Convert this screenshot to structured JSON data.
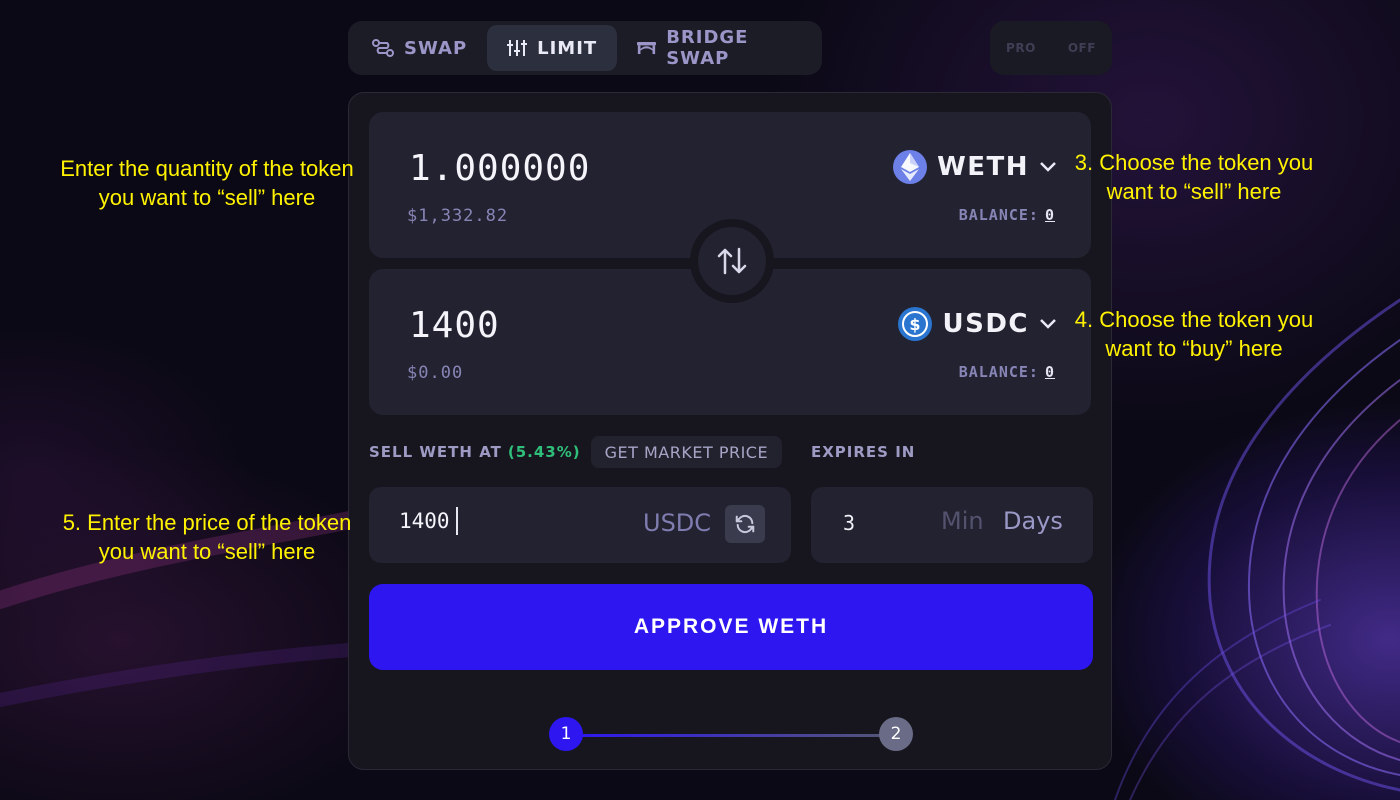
{
  "tabs": [
    {
      "label": "SWAP",
      "icon": "route-icon",
      "active": false
    },
    {
      "label": "LIMIT",
      "icon": "sliders-icon",
      "active": true
    },
    {
      "label": "BRIDGE SWAP",
      "icon": "bridge-icon",
      "active": false
    }
  ],
  "pro_toggle": {
    "pro": "PRO",
    "off": "OFF"
  },
  "sell": {
    "amount": "1.000000",
    "usd": "$1,332.82",
    "token": "WETH",
    "token_icon": "ethereum-icon",
    "balance_label": "BALANCE:",
    "balance_value": "0"
  },
  "buy": {
    "amount": "1400",
    "usd": "$0.00",
    "token": "USDC",
    "token_icon": "usdc-icon",
    "balance_label": "BALANCE:",
    "balance_value": "0"
  },
  "limit": {
    "sell_at_label": "SELL WETH AT",
    "pct": "(5.43%)",
    "market_price_label": "GET MARKET PRICE",
    "expires_label": "EXPIRES IN",
    "price_value": "1400",
    "price_unit": "USDC",
    "expires_value": "3",
    "unit_min": "Min",
    "unit_days": "Days"
  },
  "approve_label": "APPROVE WETH",
  "steps": [
    "1",
    "2"
  ],
  "annotations": {
    "qty": [
      "Enter the quantity of the token",
      "you want to “sell” here"
    ],
    "sell_token": [
      "3. Choose the token you",
      "want to “sell” here"
    ],
    "buy_token": [
      "4. Choose the token you",
      "want to “buy” here"
    ],
    "price": [
      "5. Enter the price of the token",
      "you want to “sell” here"
    ]
  },
  "colors": {
    "accent": "#2d16f0",
    "positive": "#2fbf7a",
    "annotation": "#fff200",
    "card": "#17161f",
    "panel": "#222230"
  }
}
